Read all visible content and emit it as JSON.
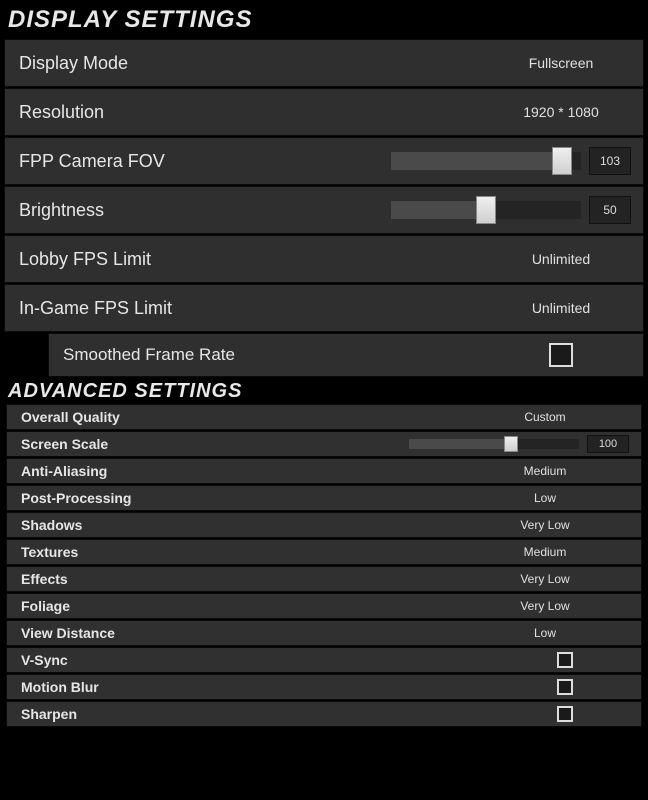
{
  "display": {
    "header": "DISPLAY SETTINGS",
    "display_mode": {
      "label": "Display Mode",
      "value": "Fullscreen"
    },
    "resolution": {
      "label": "Resolution",
      "value": "1920 * 1080"
    },
    "fpp_fov": {
      "label": "FPP Camera FOV",
      "value": "103",
      "pct": 90
    },
    "brightness": {
      "label": "Brightness",
      "value": "50",
      "pct": 50
    },
    "lobby_fps": {
      "label": "Lobby FPS Limit",
      "value": "Unlimited"
    },
    "ingame_fps": {
      "label": "In-Game FPS Limit",
      "value": "Unlimited"
    },
    "smoothed_fr": {
      "label": "Smoothed Frame Rate",
      "checked": false
    }
  },
  "advanced": {
    "header": "ADVANCED SETTINGS",
    "overall_quality": {
      "label": "Overall Quality",
      "value": "Custom"
    },
    "screen_scale": {
      "label": "Screen Scale",
      "value": "100",
      "pct": 60
    },
    "anti_aliasing": {
      "label": "Anti-Aliasing",
      "value": "Medium"
    },
    "post_processing": {
      "label": "Post-Processing",
      "value": "Low"
    },
    "shadows": {
      "label": "Shadows",
      "value": "Very Low"
    },
    "textures": {
      "label": "Textures",
      "value": "Medium"
    },
    "effects": {
      "label": "Effects",
      "value": "Very Low"
    },
    "foliage": {
      "label": "Foliage",
      "value": "Very Low"
    },
    "view_distance": {
      "label": "View Distance",
      "value": "Low"
    },
    "vsync": {
      "label": "V-Sync",
      "checked": false
    },
    "motion_blur": {
      "label": "Motion Blur",
      "checked": false
    },
    "sharpen": {
      "label": "Sharpen",
      "checked": false
    }
  }
}
